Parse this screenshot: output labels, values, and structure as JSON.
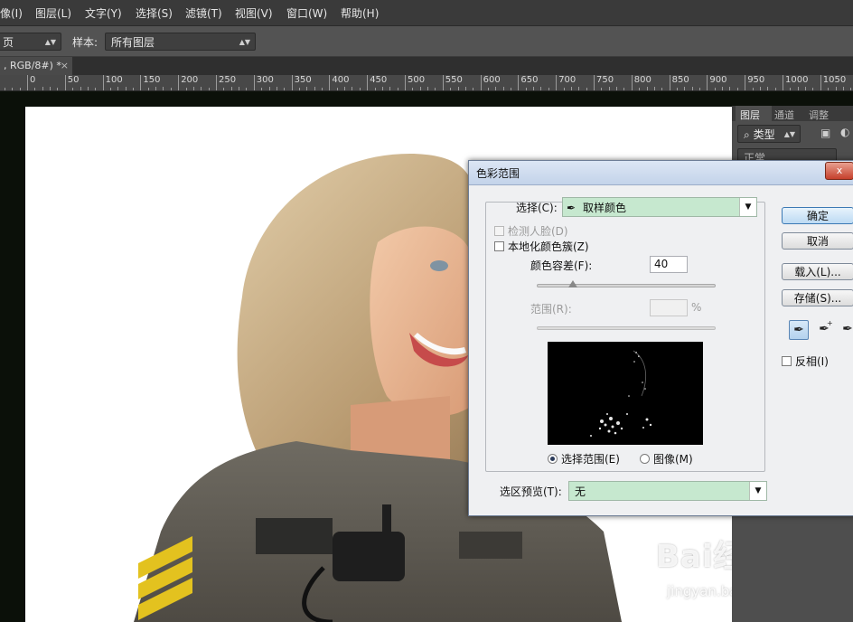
{
  "menu": [
    "像(I)",
    "图层(L)",
    "文字(Y)",
    "选择(S)",
    "滤镜(T)",
    "视图(V)",
    "窗口(W)",
    "帮助(H)"
  ],
  "options_bar": {
    "first_select_value": "页",
    "sample_label": "样本:",
    "sample_select_value": "所有图层"
  },
  "document_tab": {
    "label": ", RGB/8#) *",
    "close": "×"
  },
  "ruler_labels": [
    "0",
    "50",
    "100",
    "150",
    "200",
    "250",
    "300",
    "350",
    "400",
    "450",
    "500",
    "550",
    "600",
    "650",
    "700",
    "750",
    "800",
    "850",
    "900",
    "950",
    "1000",
    "1050"
  ],
  "layers_panel": {
    "tabs": [
      "图层",
      "通道",
      "调整"
    ],
    "filter_label": "类型",
    "blend_mode": "正常"
  },
  "dialog": {
    "title": "色彩范围",
    "close_glyph": "x",
    "select_label": "选择(C):",
    "select_value": "取样颜色",
    "detect_faces_label": "检测人脸(D)",
    "localized_clusters_label": "本地化颜色簇(Z)",
    "fuzziness_label": "颜色容差(F):",
    "fuzziness_value": "40",
    "fuzziness_fraction": 0.2,
    "range_label": "范围(R):",
    "range_unit": "%",
    "radio_selection_label": "选择范围(E)",
    "radio_image_label": "图像(M)",
    "preview_label": "选区预览(T):",
    "preview_value": "无",
    "buttons": {
      "ok": "确定",
      "cancel": "取消",
      "load": "载入(L)...",
      "save": "存储(S)..."
    },
    "invert_label": "反相(I)"
  },
  "watermark": {
    "brand": "Bai经验",
    "url": "jingyan.baidu.com"
  },
  "colors": {
    "menubar_bg": "#3a3a3a",
    "dialog_bg": "#eff0f2",
    "green_field": "#c6e8cf",
    "ok_button": "#bcdaf3"
  }
}
